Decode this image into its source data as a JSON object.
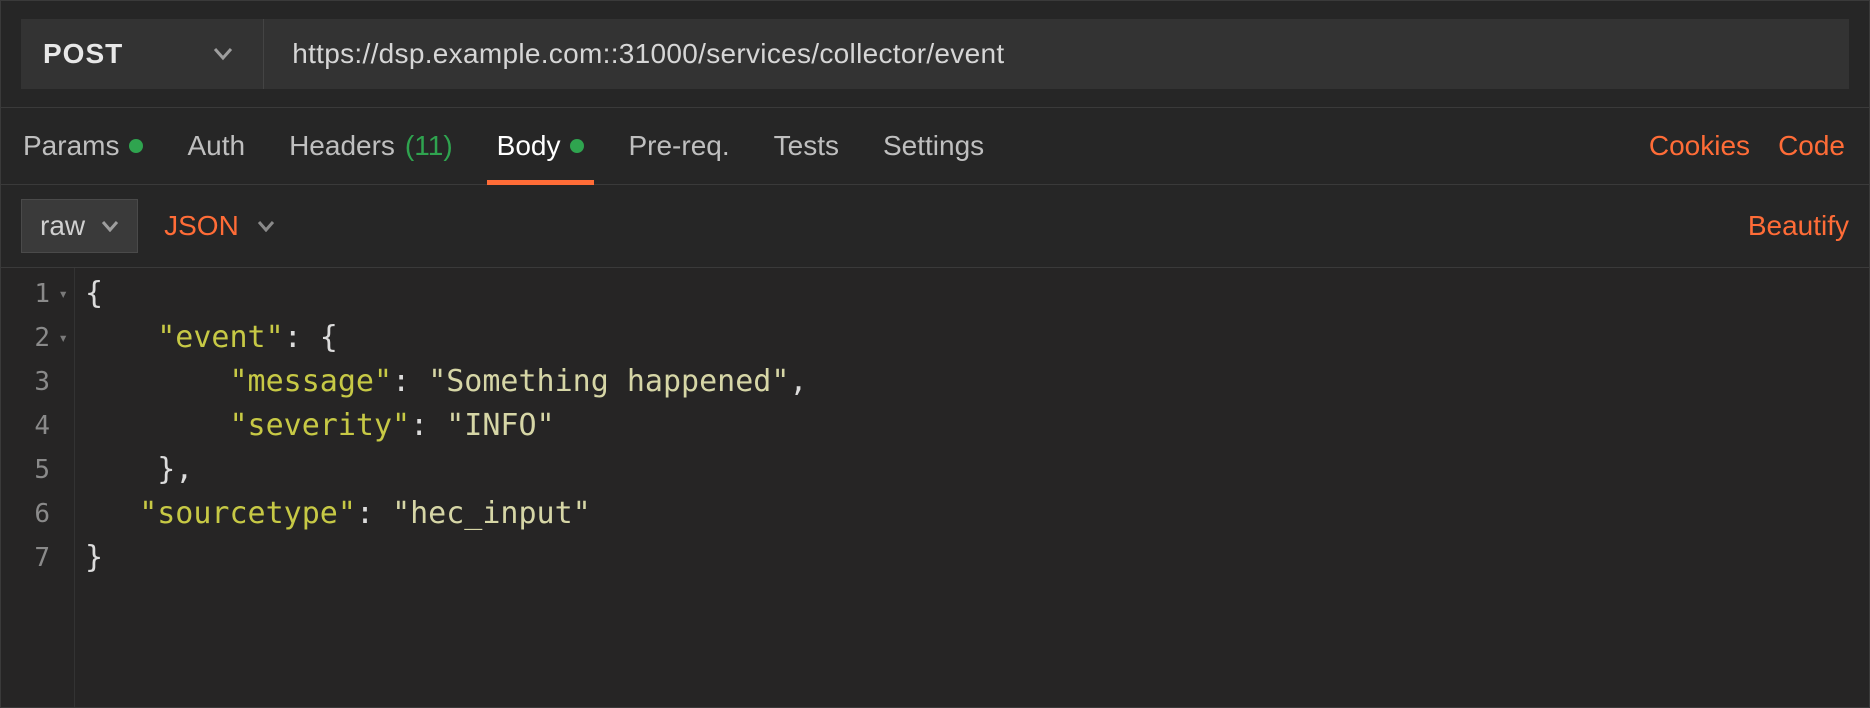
{
  "request": {
    "method": "POST",
    "url": "https://dsp.example.com::31000/services/collector/event"
  },
  "tabs": {
    "items": [
      {
        "id": "params",
        "label": "Params",
        "has_dot": true,
        "count": null,
        "active": false
      },
      {
        "id": "auth",
        "label": "Auth",
        "has_dot": false,
        "count": null,
        "active": false
      },
      {
        "id": "headers",
        "label": "Headers",
        "has_dot": false,
        "count": "(11)",
        "active": false
      },
      {
        "id": "body",
        "label": "Body",
        "has_dot": true,
        "count": null,
        "active": true
      },
      {
        "id": "prereq",
        "label": "Pre-req.",
        "has_dot": false,
        "count": null,
        "active": false
      },
      {
        "id": "tests",
        "label": "Tests",
        "has_dot": false,
        "count": null,
        "active": false
      },
      {
        "id": "settings",
        "label": "Settings",
        "has_dot": false,
        "count": null,
        "active": false
      }
    ],
    "right_links": {
      "cookies": "Cookies",
      "code": "Code"
    }
  },
  "body_subbar": {
    "mode": "raw",
    "content_type": "JSON",
    "beautify": "Beautify"
  },
  "editor": {
    "line_numbers": [
      "1",
      "2",
      "3",
      "4",
      "5",
      "6",
      "7"
    ],
    "lines": {
      "l1_brace": "{",
      "l2_key": "\"event\"",
      "l2_rest": ": {",
      "l3_key": "\"message\"",
      "l3_val": "\"Something happened\"",
      "l4_key": "\"severity\"",
      "l4_val": "\"INFO\"",
      "l5_close": "},",
      "l6_key": "\"sourcetype\"",
      "l6_val": "\"hec_input\"",
      "l7_brace": "}"
    },
    "payload_json": {
      "event": {
        "message": "Something happened",
        "severity": "INFO"
      },
      "sourcetype": "hec_input"
    }
  }
}
